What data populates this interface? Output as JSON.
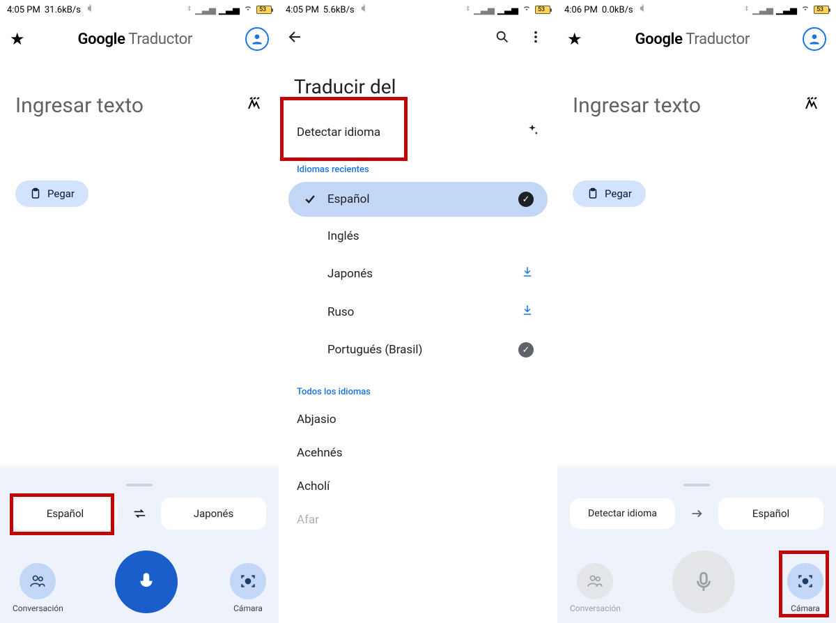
{
  "status": {
    "time1": "4:05 PM",
    "rate1": "31.6kB/s",
    "time2": "4:05 PM",
    "rate2": "5.6kB/s",
    "time3": "4:06 PM",
    "rate3": "0.0kB/s",
    "battery": "53"
  },
  "header": {
    "brand": "Google",
    "product": "Traductor"
  },
  "main": {
    "inputHint": "Ingresar texto",
    "pasteLabel": "Pegar"
  },
  "bottom1": {
    "src": "Español",
    "tgt": "Japonés",
    "conversation": "Conversación",
    "camera": "Cámara"
  },
  "bottom3": {
    "src": "Detectar idioma",
    "tgt": "Español",
    "conversation": "Conversación",
    "camera": "Cámara"
  },
  "picker": {
    "title": "Traducir del",
    "detect": "Detectar idioma",
    "recent": "Idiomas recientes",
    "all": "Todos los idiomas",
    "items": {
      "es": "Español",
      "en": "Inglés",
      "ja": "Japonés",
      "ru": "Ruso",
      "pt": "Portugués (Brasil)",
      "ab": "Abjasio",
      "ace": "Acehnés",
      "ach": "Acholí",
      "afr": "Afar"
    }
  }
}
